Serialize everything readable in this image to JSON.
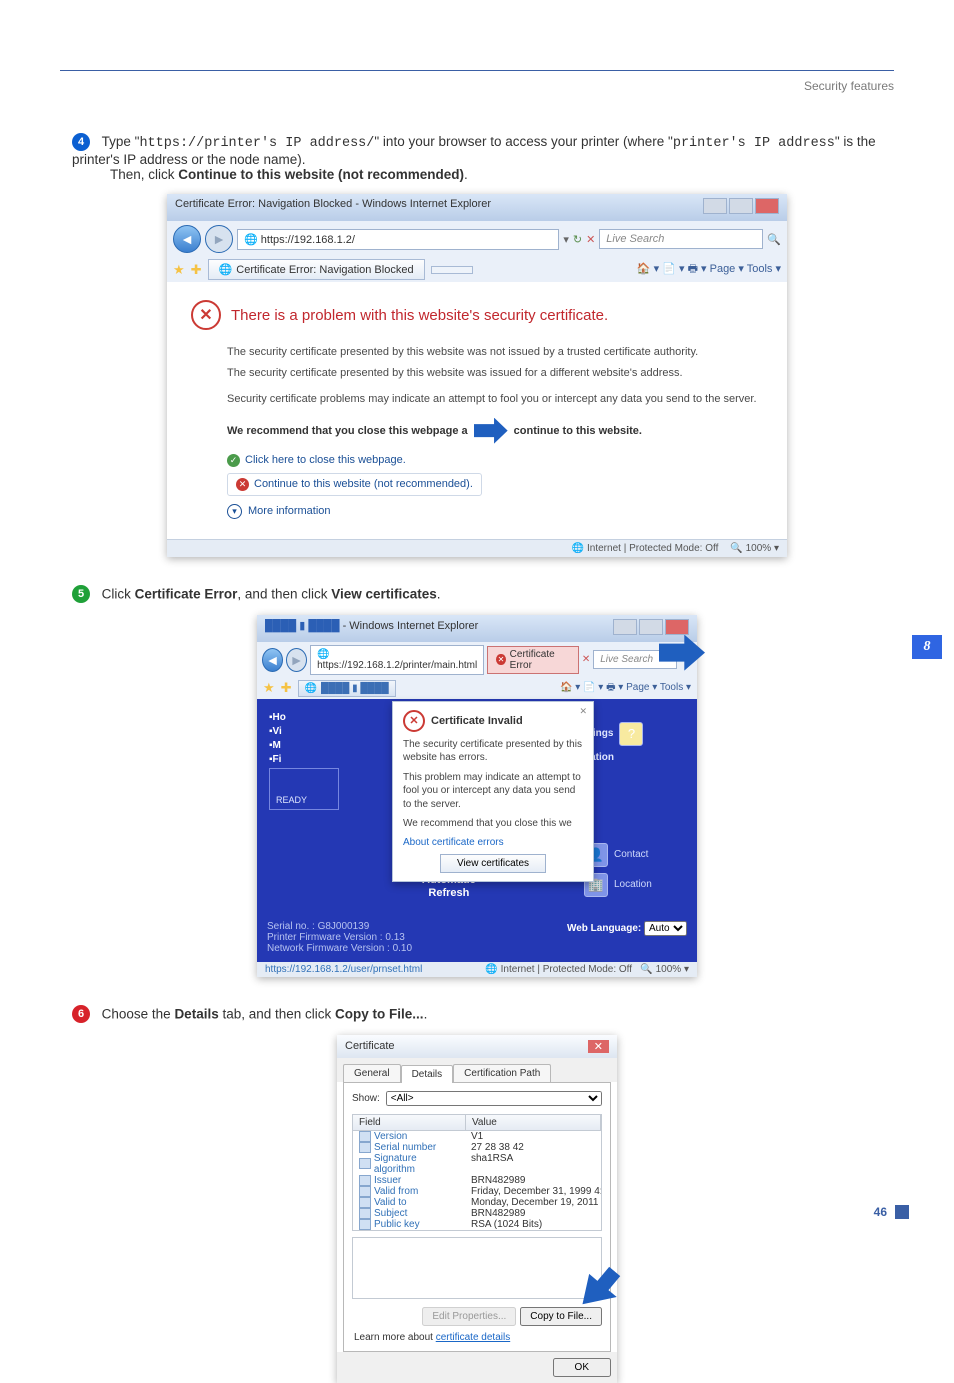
{
  "header": {
    "section": "Security features"
  },
  "sideTab": "8",
  "pageNumber": "46",
  "step4": {
    "num": "4",
    "preText": "Type \"",
    "url": "https://printer's IP address/",
    "midText": "\" into your browser to access your printer (where \"",
    "addr": "printer's IP address",
    "postText": "\" is the printer's IP address or the node name).",
    "thenClick": "Then, click ",
    "bold": "Continue to this website (not recommended)",
    "dot": "."
  },
  "shot1": {
    "title": "Certificate Error: Navigation Blocked - Windows Internet Explorer",
    "address": "https://192.168.1.2/",
    "searchPlaceholder": "Live Search",
    "tabLabel": "Certificate Error: Navigation Blocked",
    "toolLinks": "Page ▾   Tools ▾",
    "heading": "There is a problem with this website's security certificate.",
    "line1": "The security certificate presented by this website was not issued by a trusted certificate authority.",
    "line2": "The security certificate presented by this website was issued for a different website's address.",
    "line3": "Security certificate problems may indicate an attempt to fool you or intercept any data you send to the server.",
    "recA": "We recommend that you close this webpage a",
    "recB": "continue to this website.",
    "closeLink": "Click here to close this webpage.",
    "continueLink": "Continue to this website (not recommended).",
    "moreInfo": "More information",
    "statusL": "Internet | Protected Mode: Off",
    "statusR": "100%"
  },
  "step5": {
    "num": "5",
    "a": "Click ",
    "b": "Certificate Error",
    "c": ", and then click ",
    "d": "View certificates",
    "e": "."
  },
  "shot2": {
    "titleSuffix": "- Windows Internet Explorer",
    "address": "https://192.168.1.2/printer/main.html",
    "certError": "Certificate Error",
    "searchPlaceholder": "Live Search",
    "toolLinks": "Page ▾   Tools ▾",
    "popupTitle": "Certificate Invalid",
    "popupP1": "The security certificate presented by this website has errors.",
    "popupP2": "This problem may indicate an attempt to fool you or intercept any data you send to the server.",
    "popupP3": "We recommend that you close this we",
    "popupLink": "About certificate errors",
    "viewBtn": "View certificates",
    "sideH": "Ho",
    "sideV": "Vi",
    "sideM": "M",
    "sideF": "Fi",
    "ready": "READY",
    "rightS": "s",
    "rightSettings": "Settings",
    "rightGuration": "guration",
    "contact": "Contact",
    "location": "Location",
    "autoRefresh1": "Automatic",
    "autoRefresh2": "Refresh",
    "serial": "Serial no. : G8J000139",
    "pfw": "Printer Firmware Version : 0.13",
    "nfw": "Network Firmware Version : 0.10",
    "webLang": "Web Language:",
    "webLangVal": "Auto",
    "statAddr": "https://192.168.1.2/user/prnset.html",
    "statMid": "Internet | Protected Mode: Off",
    "statR": "100%"
  },
  "step6": {
    "num": "6",
    "a": "Choose the ",
    "b": "Details",
    "c": " tab, and then click ",
    "d": "Copy to File...",
    "e": "."
  },
  "shot3": {
    "title": "Certificate",
    "tabs": {
      "general": "General",
      "details": "Details",
      "path": "Certification Path"
    },
    "showLabel": "Show:",
    "showValue": "<All>",
    "colField": "Field",
    "colValue": "Value",
    "rows": [
      {
        "f": "Version",
        "v": "V1"
      },
      {
        "f": "Serial number",
        "v": "27 28 38 42"
      },
      {
        "f": "Signature algorithm",
        "v": "sha1RSA"
      },
      {
        "f": "Issuer",
        "v": "BRN482989"
      },
      {
        "f": "Valid from",
        "v": "Friday, December 31, 1999 4:..."
      },
      {
        "f": "Valid to",
        "v": "Monday, December 19, 2011 ..."
      },
      {
        "f": "Subject",
        "v": "BRN482989"
      },
      {
        "f": "Public key",
        "v": "RSA (1024 Bits)"
      }
    ],
    "editBtn": "Edit Properties...",
    "copyBtn": "Copy to File...",
    "learn": "Learn more about certificate details",
    "ok": "OK"
  }
}
